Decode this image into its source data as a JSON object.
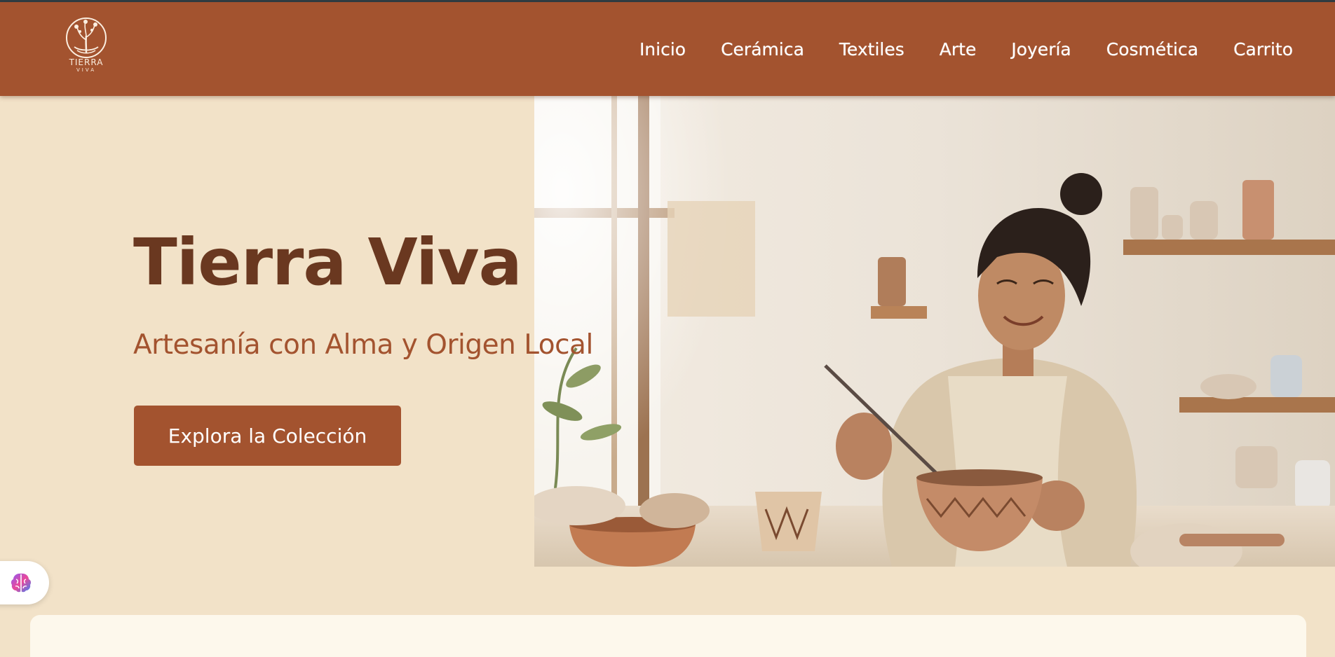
{
  "brand": {
    "logo_name": "TIERRA",
    "logo_sub": "VIVA"
  },
  "nav": {
    "items": [
      {
        "label": "Inicio",
        "name": "nav-inicio"
      },
      {
        "label": "Cerámica",
        "name": "nav-ceramica"
      },
      {
        "label": "Textiles",
        "name": "nav-textiles"
      },
      {
        "label": "Arte",
        "name": "nav-arte"
      },
      {
        "label": "Joyería",
        "name": "nav-joyeria"
      },
      {
        "label": "Cosmética",
        "name": "nav-cosmetica"
      },
      {
        "label": "Carrito",
        "name": "nav-carrito"
      }
    ]
  },
  "hero": {
    "title": "Tierra Viva",
    "subtitle": "Artesanía con Alma y Origen Local",
    "cta_label": "Explora la Colección",
    "image_icon": "artisan-potter-photo"
  },
  "widget": {
    "icon": "brain-icon"
  },
  "colors": {
    "header": "#a3532f",
    "background": "#f2e2c8",
    "title": "#6a3820",
    "accent": "#a3532f",
    "card": "#fdf8ec"
  }
}
